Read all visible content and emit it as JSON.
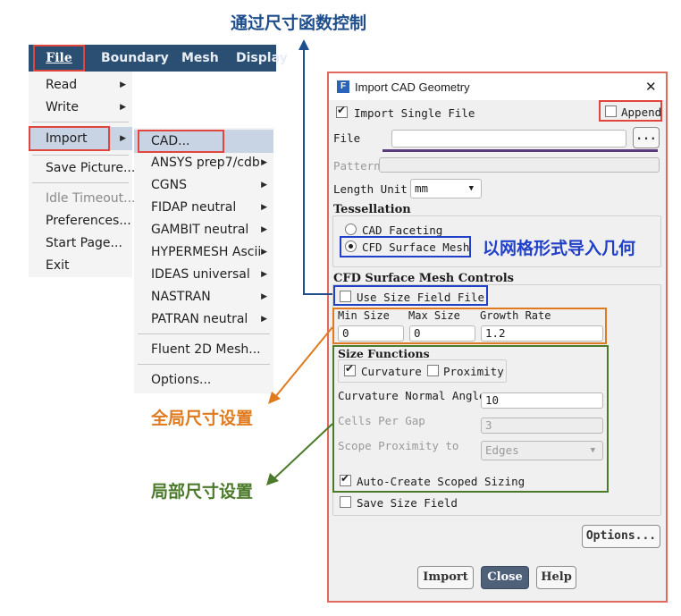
{
  "menubar": {
    "file": "File",
    "boundary": "Boundary",
    "mesh": "Mesh",
    "display": "Display"
  },
  "file_menu": {
    "read": "Read",
    "write": "Write",
    "import": "Import",
    "save_picture": "Save Picture...",
    "idle_timeout": "Idle Timeout...",
    "preferences": "Preferences...",
    "start_page": "Start Page...",
    "exit": "Exit"
  },
  "import_menu": {
    "cad": "CAD...",
    "ansys": "ANSYS prep7/cdb",
    "cgns": "CGNS",
    "fidap": "FIDAP neutral",
    "gambit": "GAMBIT neutral",
    "hypermesh": "HYPERMESH Ascii",
    "ideas": "IDEAS universal",
    "nastran": "NASTRAN",
    "patran": "PATRAN neutral",
    "fluent2d": "Fluent 2D Mesh...",
    "options": "Options..."
  },
  "dialog": {
    "title": "Import CAD Geometry",
    "app_badge": "F",
    "close_glyph": "✕",
    "import_single_file": "Import Single File",
    "append": "Append",
    "file_label": "File",
    "browse": "...",
    "pattern_label": "Pattern",
    "length_unit_label": "Length Unit",
    "length_unit_value": "mm",
    "tessellation_title": "Tessellation",
    "cad_faceting": "CAD Faceting",
    "cfd_surface_mesh": "CFD Surface Mesh",
    "controls_title": "CFD Surface Mesh Controls",
    "use_size_field_file": "Use Size Field File",
    "min_size_label": "Min Size",
    "max_size_label": "Max Size",
    "growth_rate_label": "Growth Rate",
    "min_size_value": "0",
    "max_size_value": "0",
    "growth_rate_value": "1.2",
    "size_functions_title": "Size Functions",
    "curvature": "Curvature",
    "proximity": "Proximity",
    "curvature_normal_angle_label": "Curvature Normal Angle",
    "curvature_normal_angle_value": "10",
    "cells_per_gap_label": "Cells Per Gap",
    "cells_per_gap_value": "3",
    "scope_proximity_label": "Scope Proximity to",
    "scope_proximity_value": "Edges",
    "auto_create_scoped_sizing": "Auto-Create Scoped Sizing",
    "save_size_field": "Save Size Field",
    "options_button": "Options...",
    "import_button": "Import",
    "close_button": "Close",
    "help_button": "Help"
  },
  "annotations": {
    "size_field_control": "通过尺寸函数控制",
    "import_as_mesh": "以网格形式导入几何",
    "global_size": "全局尺寸设置",
    "local_size": "局部尺寸设置"
  },
  "colors": {
    "menubar": "#2b4f73",
    "highlight_red": "#e0463d",
    "blue_note": "#1f4e8c",
    "orange_note": "#e07a1f",
    "green_note": "#4a7a2a",
    "purple_line": "#5a3a7a"
  }
}
